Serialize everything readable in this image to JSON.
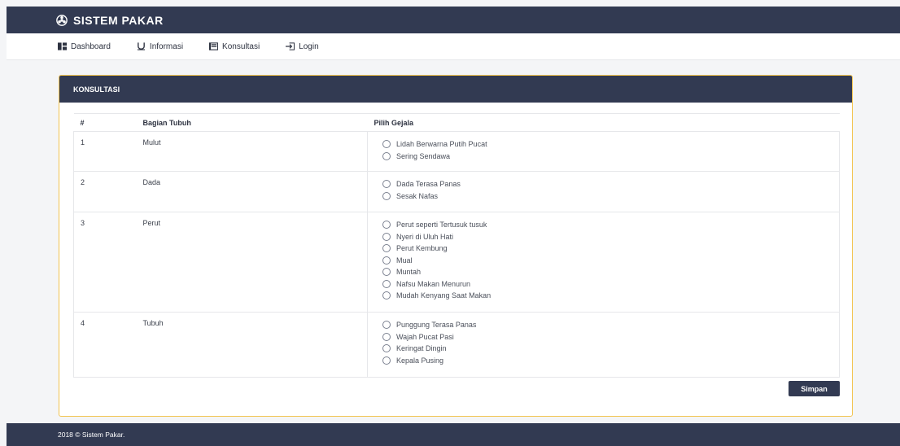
{
  "brand": {
    "title": "SISTEM PAKAR"
  },
  "nav": [
    {
      "label": "Dashboard",
      "icon": "dashboard-icon"
    },
    {
      "label": "Informasi",
      "icon": "underline-icon"
    },
    {
      "label": "Konsultasi",
      "icon": "book-icon"
    },
    {
      "label": "Login",
      "icon": "login-icon"
    }
  ],
  "card": {
    "title": "KONSULTASI"
  },
  "table": {
    "headers": {
      "no": "#",
      "part": "Bagian Tubuh",
      "symptom": "Pilih Gejala"
    },
    "rows": [
      {
        "no": "1",
        "part": "Mulut",
        "options": [
          "Lidah Berwarna Putih Pucat",
          "Sering Sendawa"
        ]
      },
      {
        "no": "2",
        "part": "Dada",
        "options": [
          "Dada Terasa Panas",
          "Sesak Nafas"
        ]
      },
      {
        "no": "3",
        "part": "Perut",
        "options": [
          "Perut seperti Tertusuk tusuk",
          "Nyeri di Uluh Hati",
          "Perut Kembung",
          "Mual",
          "Muntah",
          "Nafsu Makan Menurun",
          "Mudah Kenyang Saat Makan"
        ]
      },
      {
        "no": "4",
        "part": "Tubuh",
        "options": [
          "Punggung Terasa Panas",
          "Wajah Pucat Pasi",
          "Keringat Dingin",
          "Kepala Pusing"
        ]
      }
    ]
  },
  "submit": {
    "label": "Simpan"
  },
  "footer": {
    "text": "2018 © Sistem Pakar."
  },
  "colors": {
    "primary": "#323a52",
    "accent_border": "#f2c44f",
    "background": "#f4f5f7"
  }
}
